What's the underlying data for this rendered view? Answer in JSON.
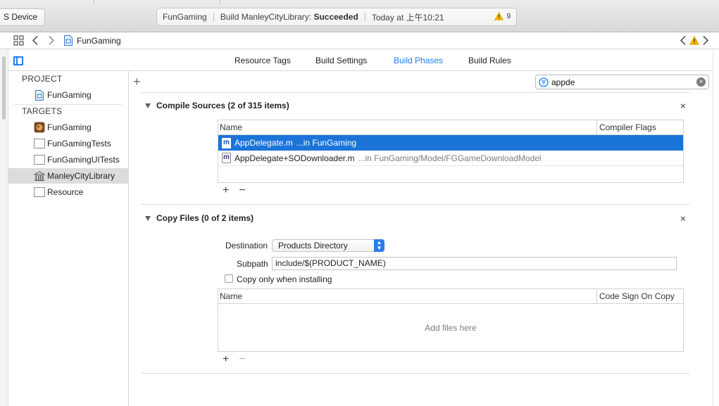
{
  "toolbar": {
    "device_label": "S Device",
    "status": {
      "project": "FunGaming",
      "build_prefix": "Build ManleyCityLibrary:",
      "build_result": "Succeeded",
      "time": "Today at 上午10:21",
      "warning_count": "9"
    }
  },
  "jumpbar": {
    "project_name": "FunGaming"
  },
  "tabs": [
    {
      "label": "Resource Tags"
    },
    {
      "label": "Build Settings"
    },
    {
      "label": "Build Phases"
    },
    {
      "label": "Build Rules"
    }
  ],
  "sidebar": {
    "project_header": "PROJECT",
    "project_item": "FunGaming",
    "targets_header": "TARGETS",
    "targets": [
      {
        "label": "FunGaming"
      },
      {
        "label": "FunGamingTests"
      },
      {
        "label": "FunGamingUITests"
      },
      {
        "label": "ManleyCityLibrary"
      },
      {
        "label": "Resource"
      }
    ]
  },
  "filter": {
    "value": "appde"
  },
  "compile_sources": {
    "title": "Compile Sources (2 of 315 items)",
    "col_name": "Name",
    "col_flags": "Compiler Flags",
    "files": [
      {
        "name": "AppDelegate.m",
        "path": "...in FunGaming"
      },
      {
        "name": "AppDelegate+SODownloader.m",
        "path": "...in FunGaming/Model/FGGameDownloadModel"
      }
    ],
    "add": "+",
    "remove": "−"
  },
  "copy_files": {
    "title": "Copy Files (0 of 2 items)",
    "destination_label": "Destination",
    "destination_value": "Products Directory",
    "subpath_label": "Subpath",
    "subpath_value": "include/$(PRODUCT_NAME)",
    "checkbox_label": "Copy only when installing",
    "col_name": "Name",
    "col_sign": "Code Sign On Copy",
    "empty_message": "Add files here",
    "add": "+",
    "remove": "−"
  },
  "colors": {
    "accent": "#1d7ff0",
    "selection": "#1b74d8",
    "warning": "#f5b800"
  }
}
